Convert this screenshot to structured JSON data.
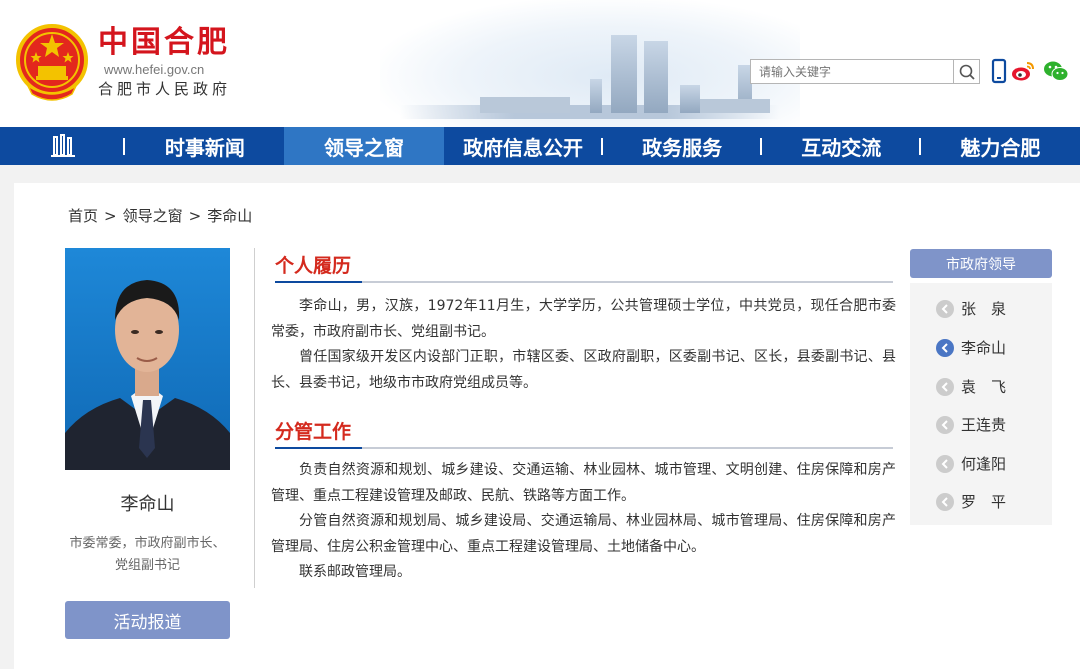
{
  "header": {
    "site_title": "中国合肥",
    "site_url": "www.hefei.gov.cn",
    "site_subtitle": "合肥市人民政府",
    "search_placeholder": "请输入关键字"
  },
  "nav": {
    "items": [
      {
        "label": "时事新闻"
      },
      {
        "label": "领导之窗"
      },
      {
        "label": "政府信息公开"
      },
      {
        "label": "政务服务"
      },
      {
        "label": "互动交流"
      },
      {
        "label": "魅力合肥"
      }
    ],
    "active_index": 1
  },
  "breadcrumb": {
    "items": [
      "首页",
      ">",
      "领导之窗",
      ">",
      "李命山"
    ]
  },
  "leader": {
    "name": "李命山",
    "title_line1": "市委常委，市政府副市长、",
    "title_line2": "党组副书记",
    "activity_button": "活动报道"
  },
  "sections": {
    "resume": {
      "title": "个人履历",
      "paragraphs": [
        "李命山，男，汉族，1972年11月生，大学学历，公共管理硕士学位，中共党员，现任合肥市委常委，市政府副市长、党组副书记。",
        "曾任国家级开发区内设部门正职，市辖区委、区政府副职，区委副书记、区长，县委副书记、县长、县委书记，地级市市政府党组成员等。"
      ]
    },
    "duties": {
      "title": "分管工作",
      "paragraphs": [
        "负责自然资源和规划、城乡建设、交通运输、林业园林、城市管理、文明创建、住房保障和房产管理、重点工程建设管理及邮政、民航、铁路等方面工作。",
        "分管自然资源和规划局、城乡建设局、交通运输局、林业园林局、城市管理局、住房保障和房产管理局、住房公积金管理中心、重点工程建设管理局、土地储备中心。",
        "联系邮政管理局。"
      ]
    }
  },
  "sidebar": {
    "header": "市政府领导",
    "items": [
      {
        "label": "张　泉"
      },
      {
        "label": "李命山"
      },
      {
        "label": "袁　飞"
      },
      {
        "label": "王连贵"
      },
      {
        "label": "何逢阳"
      },
      {
        "label": "罗　平"
      }
    ],
    "active_index": 1
  },
  "colors": {
    "nav_bg": "#0d4a9f",
    "nav_active": "#2f76c4",
    "title_red": "#d4151d",
    "button_bg": "#7f94c9"
  }
}
